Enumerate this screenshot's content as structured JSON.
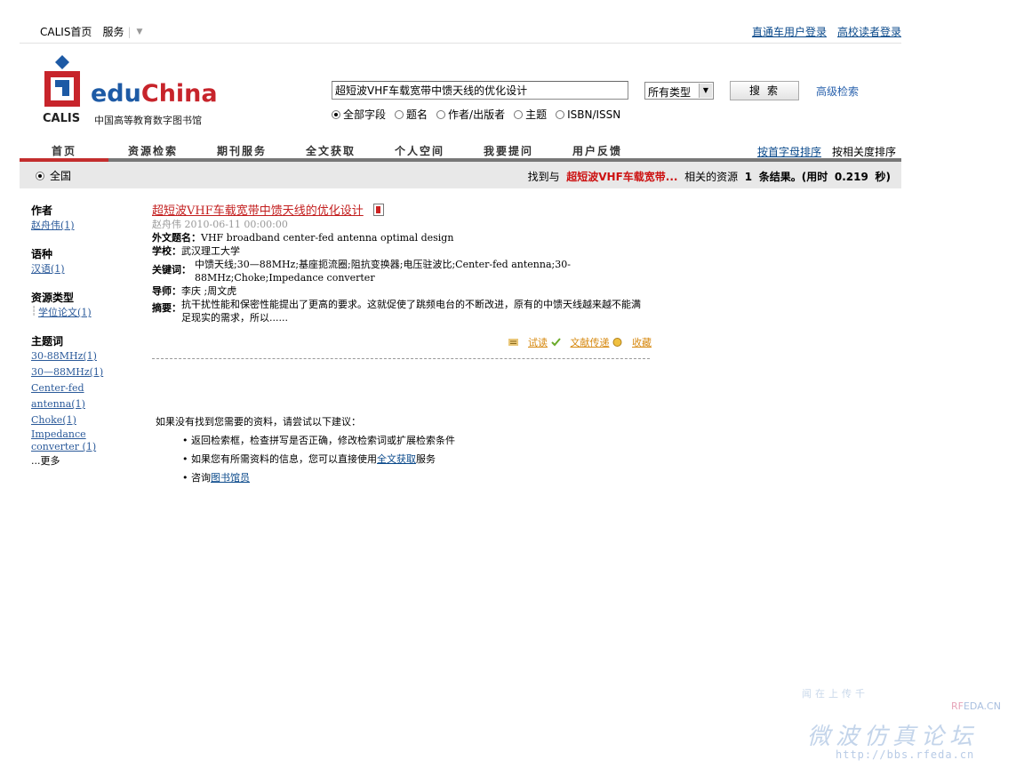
{
  "topbar": {
    "home": "CALIS首页",
    "services": "服务",
    "login_direct": "直通车用户登录",
    "login_reader": "高校读者登录"
  },
  "logo": {
    "brand_edu": "edu",
    "brand_china": "China",
    "calis": "CALIS",
    "subtitle": "中国高等教育数字图书馆"
  },
  "search": {
    "query": "超短波VHF车载宽带中馈天线的优化设计",
    "type_selected": "所有类型",
    "button": "搜索",
    "advanced": "高级检索",
    "fields": [
      {
        "label": "全部字段",
        "checked": true
      },
      {
        "label": "题名",
        "checked": false
      },
      {
        "label": "作者/出版者",
        "checked": false
      },
      {
        "label": "主题",
        "checked": false
      },
      {
        "label": "ISBN/ISSN",
        "checked": false
      }
    ]
  },
  "nav": {
    "items": [
      "首页",
      "资源检索",
      "期刊服务",
      "全文获取",
      "个人空间",
      "我要提问",
      "用户反馈"
    ],
    "sort_alpha": "按首字母排序",
    "sort_relevance": "按相关度排序"
  },
  "results": {
    "scope": "全国",
    "prefix": "找到与",
    "keyword": "超短波VHF车载宽带...",
    "middle": "相关的资源",
    "count": "1",
    "unit": "条结果。(用时",
    "time": "0.219",
    "suffix": "秒)"
  },
  "sidebar": {
    "author": {
      "heading": "作者",
      "items": [
        "赵舟伟(1)"
      ]
    },
    "language": {
      "heading": "语种",
      "items": [
        "汉语(1)"
      ]
    },
    "restype": {
      "heading": "资源类型",
      "items": [
        "学位论文(1)"
      ]
    },
    "subject": {
      "heading": "主题词",
      "items": [
        "30-88MHz(1)",
        "30—88MHz(1)",
        "Center-fed antenna(1)",
        "Choke(1)",
        "Impedance converter (1)"
      ],
      "more": "...更多"
    }
  },
  "record": {
    "title": "超短波VHF车载宽带中馈天线的优化设计",
    "meta": "赵舟伟 2010-06-11 00:00:00",
    "foreign_title_label": "外文题名：",
    "foreign_title": "VHF broadband center-fed antenna optimal design",
    "school_label": "学校：",
    "school": "武汉理工大学",
    "keywords_label": "关键词：",
    "keywords": "中馈天线;30—88MHz;基座扼流圈;阻抗变换器;电压驻波比;Center-fed antenna;30-88MHz;Choke;Impedance converter",
    "advisor_label": "导师：",
    "advisor": "李庆 ;周文虎",
    "abstract_label": "摘要：",
    "abstract": "抗干扰性能和保密性能提出了更高的要求。这就促使了跳频电台的不断改进，原有的中馈天线越来越不能满足现实的需求，所以......",
    "actions": [
      "试读",
      "文献传递",
      "收藏"
    ]
  },
  "tips": {
    "intro": "如果没有找到您需要的资料，请尝试以下建议：",
    "tip1": "返回检索框，检查拼写是否正确，修改检索词或扩展检索条件",
    "tip2_pre": "如果您有所需资料的信息，您可以直接使用",
    "tip2_link": "全文获取",
    "tip2_post": "服务",
    "tip3_pre": "咨询",
    "tip3_link": "图书馆员"
  },
  "watermark": {
    "top": "闻在上传千",
    "rf": "RF",
    "eda": "EDA.CN",
    "big": "微波仿真论坛",
    "url": "http://bbs.rfeda.cn"
  },
  "colors": {
    "brand_blue": "#1d5aa5",
    "brand_red": "#c7242b",
    "title_red": "#c31f1f",
    "action_orange": "#d78a12",
    "link_blue": "#0b4a8b"
  }
}
